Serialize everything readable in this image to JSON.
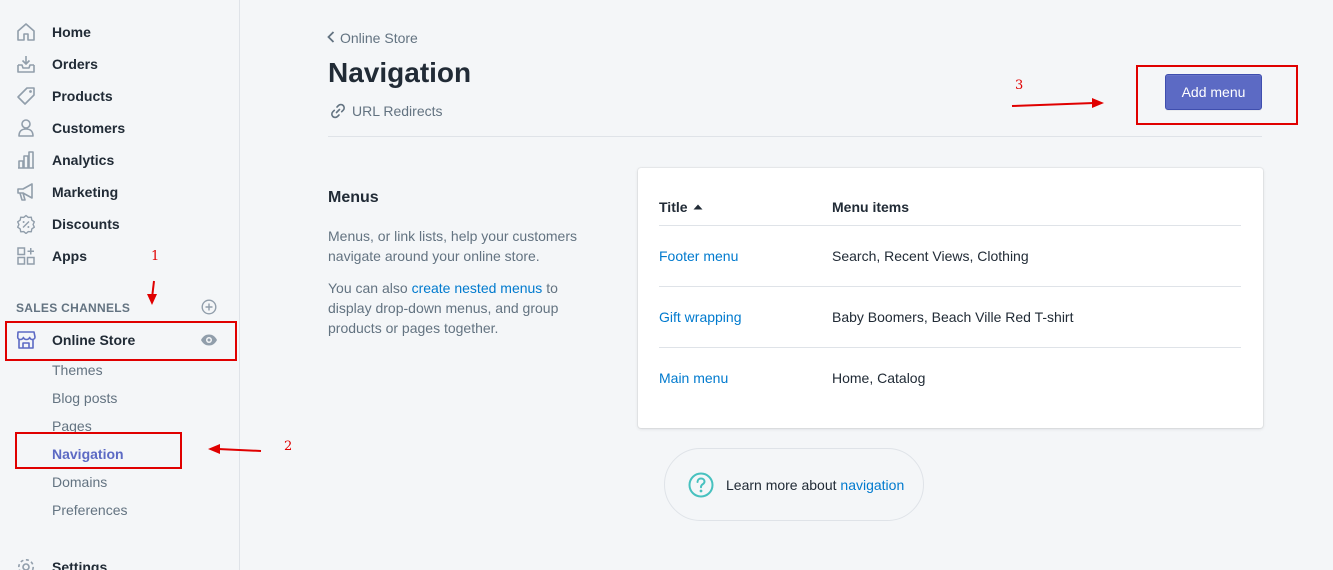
{
  "sidebar": {
    "items": [
      {
        "label": "Home",
        "icon": "home-icon"
      },
      {
        "label": "Orders",
        "icon": "orders-icon"
      },
      {
        "label": "Products",
        "icon": "tag-icon"
      },
      {
        "label": "Customers",
        "icon": "person-icon"
      },
      {
        "label": "Analytics",
        "icon": "bar-chart-icon"
      },
      {
        "label": "Marketing",
        "icon": "megaphone-icon"
      },
      {
        "label": "Discounts",
        "icon": "discount-icon"
      },
      {
        "label": "Apps",
        "icon": "apps-icon"
      }
    ],
    "sales_channels_label": "SALES CHANNELS",
    "online_store": {
      "label": "Online Store",
      "icon": "store-icon"
    },
    "sub_items": [
      "Themes",
      "Blog posts",
      "Pages",
      "Navigation",
      "Domains",
      "Preferences"
    ],
    "active_sub_item": "Navigation",
    "settings_label": "Settings"
  },
  "header": {
    "breadcrumb": "Online Store",
    "title": "Navigation",
    "secondary_action": "URL Redirects",
    "primary_action": "Add menu"
  },
  "annotation": {
    "title": "Menus",
    "description": "Menus, or link lists, help your customers navigate around your online store.",
    "desc2_prefix": "You can also ",
    "desc2_link": "create nested menus",
    "desc2_suffix": " to display drop-down menus, and group products or pages together."
  },
  "table": {
    "columns": [
      "Title",
      "Menu items"
    ],
    "rows": [
      {
        "title": "Footer menu",
        "items": "Search, Recent Views, Clothing"
      },
      {
        "title": "Gift wrapping",
        "items": "Baby Boomers, Beach Ville Red T-shirt"
      },
      {
        "title": "Main menu",
        "items": "Home, Catalog"
      }
    ]
  },
  "footer_help": {
    "prefix": "Learn more about ",
    "link": "navigation"
  },
  "steps": [
    "1",
    "2",
    "3"
  ],
  "colors": {
    "accent": "#5c6ac4",
    "link": "#007ace",
    "annotation_red": "#e00000",
    "help_teal": "#47c1bf"
  }
}
